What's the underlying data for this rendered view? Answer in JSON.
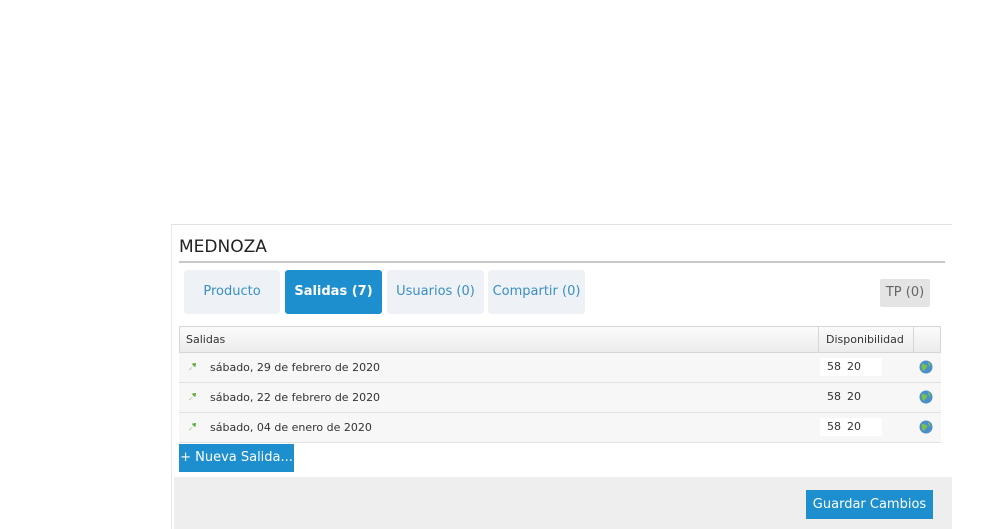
{
  "header": {
    "title": "MEDNOZA"
  },
  "tabs": [
    {
      "label": "Producto"
    },
    {
      "label": "Salidas (7)",
      "active": true
    },
    {
      "label": "Usuarios (0)"
    },
    {
      "label": "Compartir (0)"
    }
  ],
  "tp_button": {
    "label": "TP (0)"
  },
  "table": {
    "headers": {
      "salidas": "Salidas",
      "disponibilidad": "Disponibilidad"
    },
    "rows": [
      {
        "date": "sábado, 29 de febrero de 2020",
        "qty1": "58",
        "qty2": "20"
      },
      {
        "date": "sábado, 22 de febrero de 2020",
        "qty1": "58",
        "qty2": "20"
      },
      {
        "date": "sábado, 04 de enero de 2020",
        "qty1": "58",
        "qty2": "20"
      }
    ]
  },
  "actions": {
    "new_label": "+ Nueva Salida...",
    "save_label": "Guardar Cambios"
  },
  "colors": {
    "accent": "#1d8fcf",
    "tab_link": "#3a8fc4",
    "arrow": "#5fa83a"
  }
}
